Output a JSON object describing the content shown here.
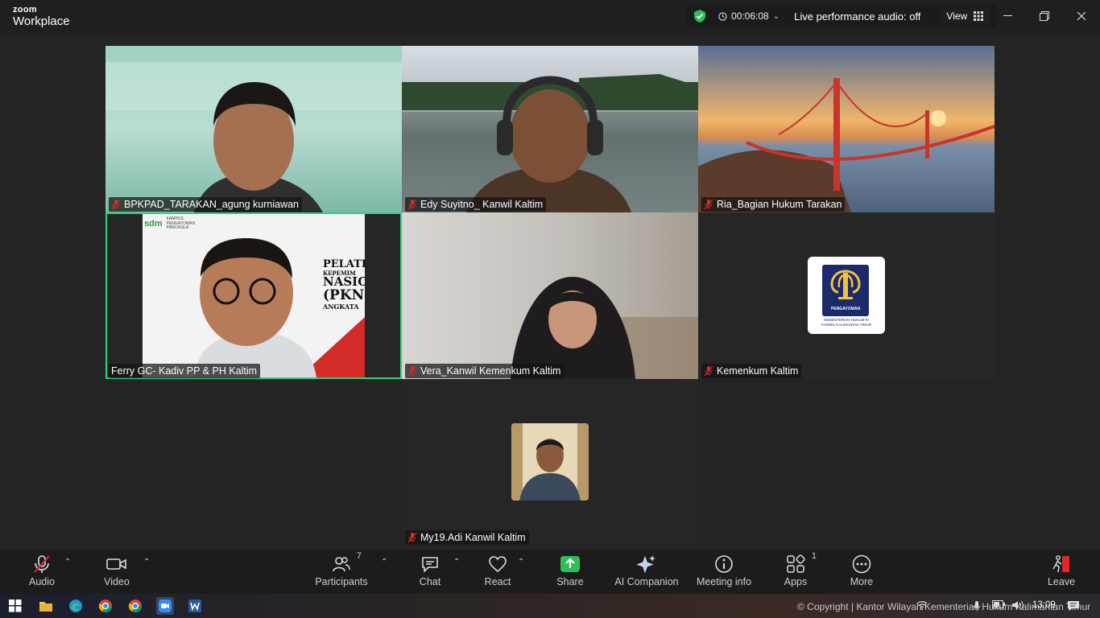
{
  "app": {
    "brand_top": "zoom",
    "brand_bottom": "Workplace",
    "timer": "00:06:08",
    "live_audio": "Live performance audio: off",
    "view_label": "View"
  },
  "colors": {
    "active_speaker": "#2fd07a",
    "share_green": "#2ebd59",
    "muted_red": "#e02828",
    "background": "#242424"
  },
  "participants": [
    {
      "name": "BPKPAD_TARAKAN_agung kurniawan",
      "muted": true
    },
    {
      "name": "Edy Suyitno_ Kanwil Kaltim",
      "muted": true
    },
    {
      "name": "Ria_Bagian Hukum Tarakan",
      "muted": true
    },
    {
      "name": "Ferry GC- Kadiv PP & PH Kaltim",
      "muted": false,
      "active": true
    },
    {
      "name": "Vera_Kanwil Kemenkum Kaltim",
      "muted": true
    },
    {
      "name": "Kemenkum Kaltim",
      "muted": true
    },
    {
      "name": "My19.Adi Kanwil Kaltim",
      "muted": true
    }
  ],
  "slide_text": {
    "brand": "sdm",
    "brand_sub1": "KAMPUS",
    "brand_sub2": "PENGAYOMAN",
    "brand_sub3": "PANCASILA",
    "line1": "PELATI",
    "line2": "KEPEMIM",
    "line3": "NASIO",
    "line4": "(PKN",
    "line5": "ANGKATA"
  },
  "logo_text": {
    "line1": "PENGAYOMAN",
    "line2": "KEMENTERIAN HUKUM RI",
    "line3": "KANWIL KALIMANTAN TIMUR"
  },
  "toolbar": {
    "audio": "Audio",
    "video": "Video",
    "participants": "Participants",
    "participants_count": "7",
    "chat": "Chat",
    "react": "React",
    "share": "Share",
    "ai_companion": "AI Companion",
    "meeting_info": "Meeting info",
    "apps": "Apps",
    "apps_count": "1",
    "more": "More",
    "leave": "Leave"
  },
  "taskbar": {
    "copyright": "© Copyright | Kantor Wilayah Kementerian Hukum Kalimantan Timur",
    "time": "13:09"
  }
}
